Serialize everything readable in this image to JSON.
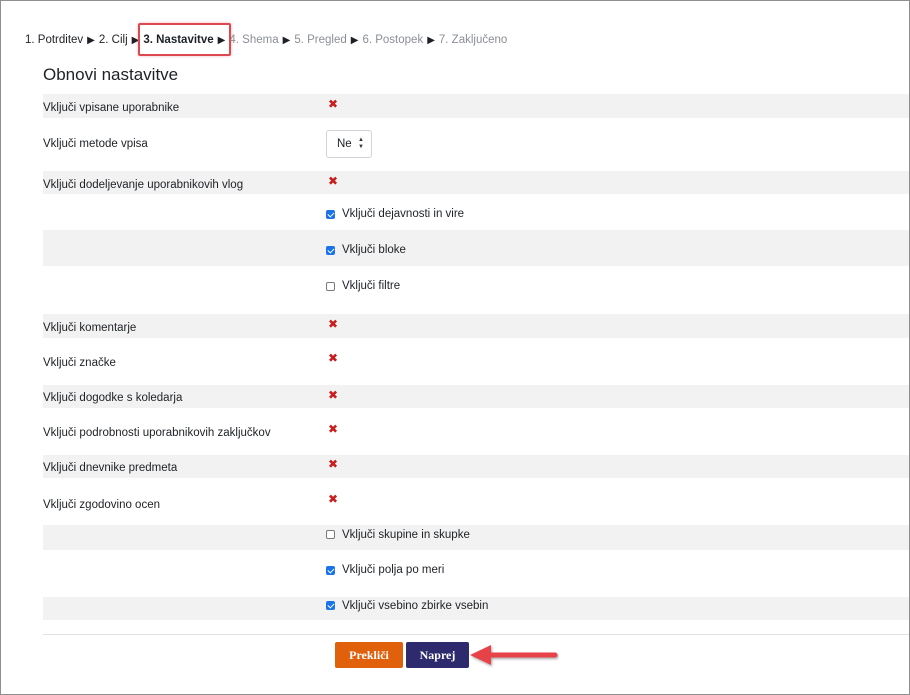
{
  "steps": [
    {
      "label": "1. Potrditev",
      "state": "done"
    },
    {
      "label": "2. Cilj",
      "state": "done"
    },
    {
      "label": "3. Nastavitve",
      "state": "current"
    },
    {
      "label": "4. Shema",
      "state": "future"
    },
    {
      "label": "5. Pregled",
      "state": "future"
    },
    {
      "label": "6. Postopek",
      "state": "future"
    },
    {
      "label": "7. Zaključeno",
      "state": "future"
    }
  ],
  "step_separator": "▶",
  "section_title": "Obnovi nastavitve",
  "settings": {
    "enrolled_users": {
      "label": "Vključi vpisane uporabnike",
      "value_icon": "x-icon",
      "value": "✖"
    },
    "enrol_methods": {
      "label": "Vključi metode vpisa",
      "value": "Ne"
    },
    "role_assignments": {
      "label": "Vključi dodeljevanje uporabnikovih vlog",
      "value_icon": "x-icon",
      "value": "✖"
    },
    "activities": {
      "label": "Vključi dejavnosti in vire",
      "checked": true
    },
    "blocks": {
      "label": "Vključi bloke",
      "checked": true
    },
    "filters": {
      "label": "Vključi filtre",
      "checked": false
    },
    "comments": {
      "label": "Vključi komentarje",
      "value_icon": "x-icon",
      "value": "✖"
    },
    "badges": {
      "label": "Vključi značke",
      "value_icon": "x-icon",
      "value": "✖"
    },
    "calendar_events": {
      "label": "Vključi dogodke s koledarja",
      "value_icon": "x-icon",
      "value": "✖"
    },
    "completion_details": {
      "label": "Vključi podrobnosti uporabnikovih zaključkov",
      "value_icon": "x-icon",
      "value": "✖"
    },
    "course_logs": {
      "label": "Vključi dnevnike predmeta",
      "value_icon": "x-icon",
      "value": "✖"
    },
    "grade_history": {
      "label": "Vključi zgodovino ocen",
      "value_icon": "x-icon",
      "value": "✖"
    },
    "groups": {
      "label": "Vključi skupine in skupke",
      "checked": false
    },
    "custom_fields": {
      "label": "Vključi polja po meri",
      "checked": true
    },
    "content_bank": {
      "label": "Vključi vsebino zbirke vsebin",
      "checked": true
    }
  },
  "buttons": {
    "cancel_label": "Prekliči",
    "next_label": "Naprej"
  },
  "colors": {
    "highlight_box": "#e0484f",
    "cancel_button": "#e0600c",
    "next_button": "#2e2a6e",
    "x_mark": "#c71e1e",
    "checkbox_checked": "#1a73e8",
    "arrow": "#e8434a"
  }
}
